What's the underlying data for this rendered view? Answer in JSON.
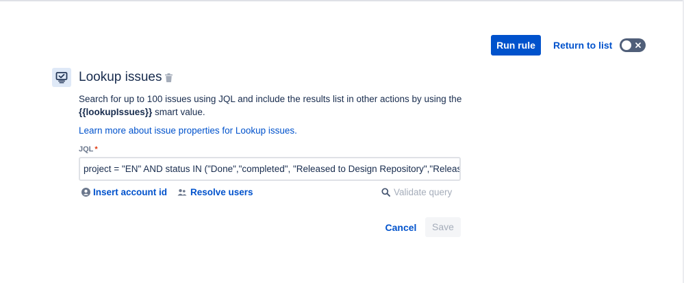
{
  "header": {
    "run_rule_label": "Run rule",
    "return_label": "Return to list",
    "toggle_state": "off"
  },
  "component": {
    "icon": "monitor-check-icon",
    "title": "Lookup issues",
    "description_line1": "Search for up to 100 issues using JQL and include the results list in other actions by using the",
    "smart_value": "{{lookupIssues}}",
    "description_line2_suffix": " smart value.",
    "learn_more_link": "Learn more about issue properties for Lookup issues."
  },
  "jql": {
    "label": "JQL",
    "required_marker": "*",
    "value": "project = \"EN\" AND status IN (\"Done\",\"completed\", \"Released to Design Repository\",\"Released to Production\")"
  },
  "helpers": {
    "insert_account_label": "Insert account id",
    "resolve_users_label": "Resolve users",
    "validate_query_label": "Validate query"
  },
  "footer": {
    "cancel_label": "Cancel",
    "save_label": "Save"
  },
  "colors": {
    "primary": "#0052cc",
    "text": "#172b4d",
    "subtle": "#6b778c",
    "disabled": "#a5adba",
    "required": "#de350b",
    "toggle_off": "#505f79"
  }
}
